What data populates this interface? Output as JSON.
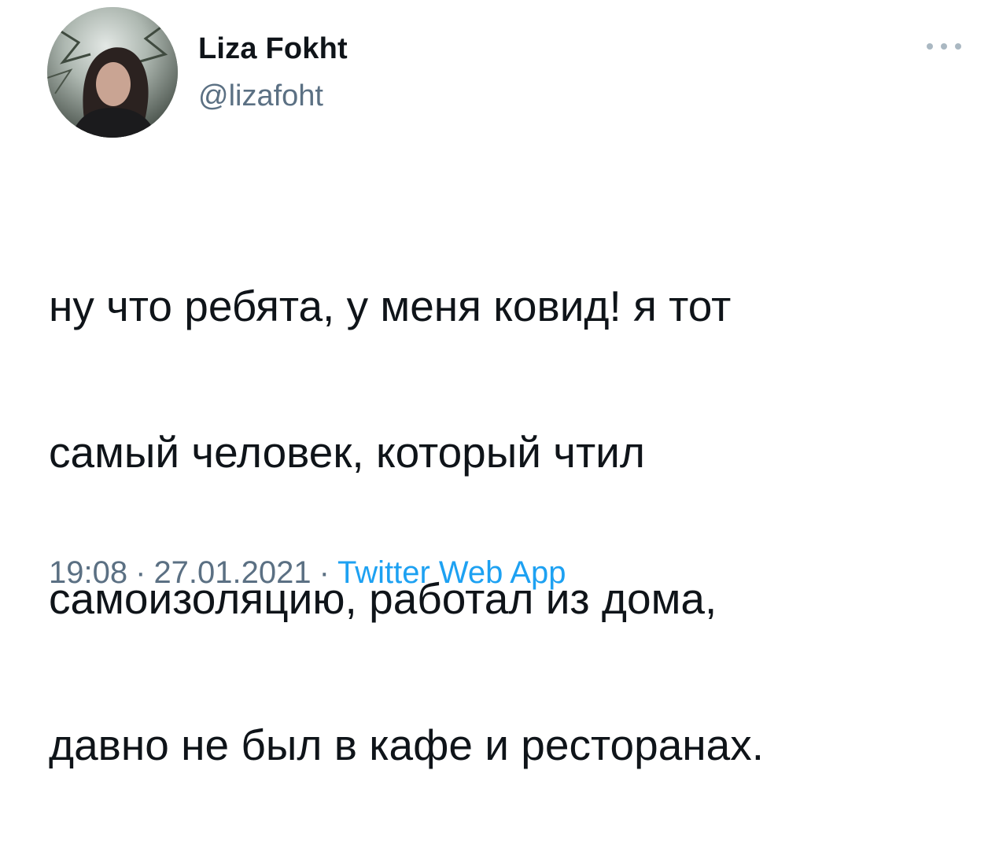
{
  "tweet": {
    "author": {
      "display_name": "Liza Fokht",
      "handle": "@lizafoht"
    },
    "text_lines": [
      "ну что ребята, у меня ковид! я тот",
      "самый человек, который чтил",
      "самоизоляцию, работал из дома,",
      "давно не был в кафе и ресторанах."
    ],
    "time": "19:08",
    "separator": "·",
    "date": "27.01.2021",
    "source": "Twitter Web App"
  },
  "icons": {
    "more": "more-horizontal-icon",
    "avatar": "profile-photo"
  },
  "colors": {
    "text": "#0f1419",
    "secondary": "#5b7083",
    "link": "#1da1f2",
    "more_dots": "#aab8c2"
  }
}
